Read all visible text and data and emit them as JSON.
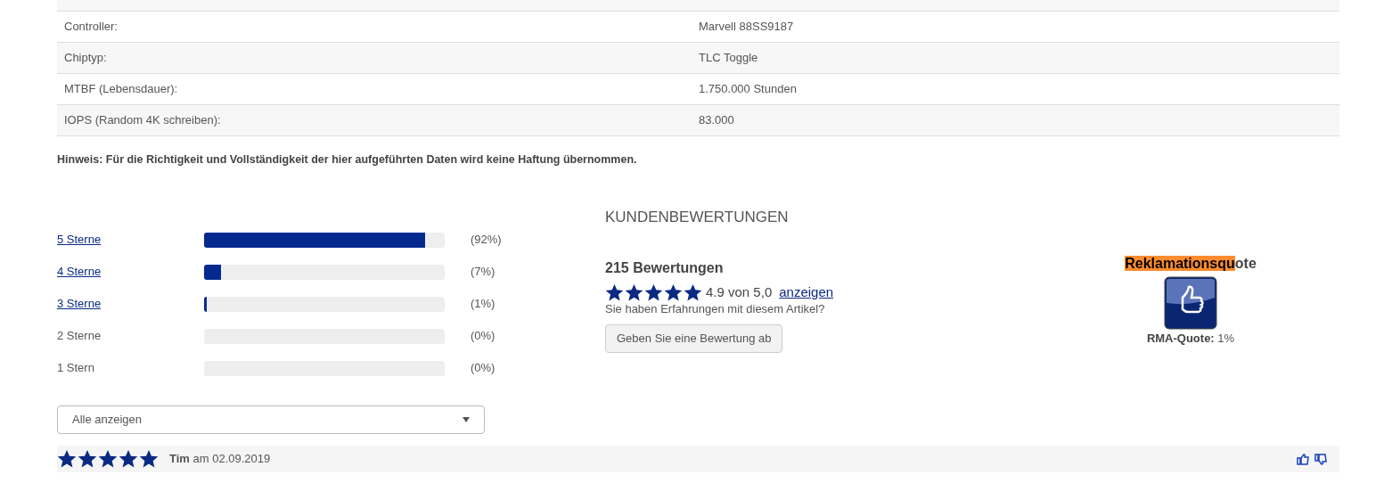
{
  "specs": [
    {
      "label": "Controller:",
      "value": "Marvell 88SS9187"
    },
    {
      "label": "Chiptyp:",
      "value": "TLC Toggle"
    },
    {
      "label": "MTBF (Lebensdauer):",
      "value": "1.750.000 Stunden"
    },
    {
      "label": "IOPS (Random 4K schreiben):",
      "value": "83.000"
    }
  ],
  "note": "Hinweis: Für die Richtigkeit und Vollständigkeit der hier aufgeführten Daten wird keine Haftung übernommen.",
  "distribution": [
    {
      "label": "5 Sterne",
      "link": true,
      "level": 0.92,
      "percent": "(92%)"
    },
    {
      "label": "4 Sterne",
      "link": true,
      "level": 0.07,
      "percent": "(7%)"
    },
    {
      "label": "3 Sterne",
      "link": true,
      "level": 0.01,
      "percent": "(1%)"
    },
    {
      "label": "2 Sterne",
      "link": false,
      "level": 0,
      "percent": "(0%)"
    },
    {
      "label": "1 Stern",
      "link": false,
      "level": 0,
      "percent": "(0%)"
    }
  ],
  "summary": {
    "heading": "KUNDENBEWERTUNGEN",
    "count": "215 Bewertungen",
    "stars": 5,
    "score": "4.9 von 5,0",
    "link": "anzeigen",
    "question": "Sie haben Erfahrungen mit diesem Artikel?",
    "button": "Geben Sie eine Bewertung ab"
  },
  "rma": {
    "title_highlighted": "Reklamationsqu",
    "title_rest": "ote",
    "label": "RMA-Quote:",
    "value": "1%"
  },
  "filter": {
    "value": "Alle anzeigen"
  },
  "reviews": [
    {
      "stars": 5,
      "byline": "**Tim** am 02.09.2019"
    }
  ]
}
